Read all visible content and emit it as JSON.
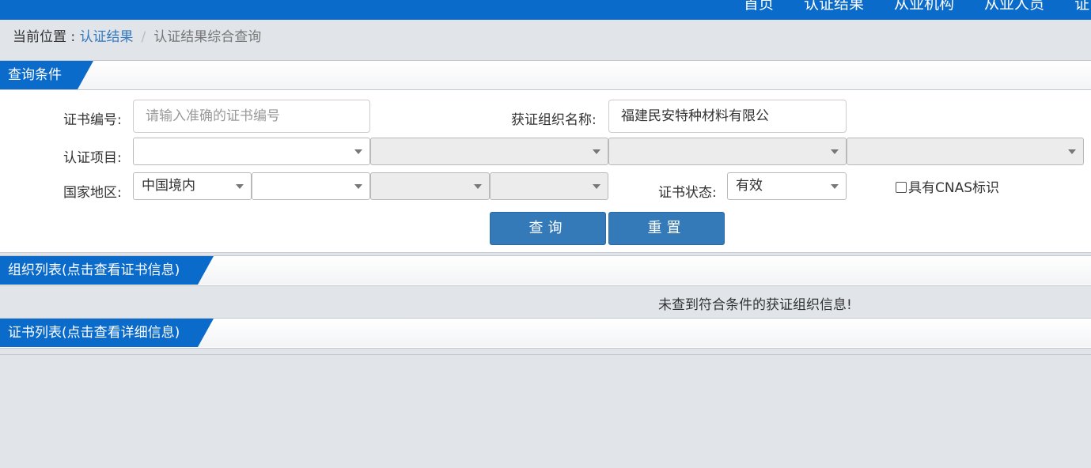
{
  "nav": {
    "items": [
      "首页",
      "认证结果",
      "从业机构",
      "从业人员",
      "证"
    ]
  },
  "breadcrumb": {
    "prefix": "当前位置 : ",
    "link": "认证结果",
    "separator": "/",
    "current": "认证结果综合查询"
  },
  "query_panel": {
    "title": "查询条件",
    "cert_no_label": "证书编号:",
    "cert_no_placeholder": "请输入准确的证书编号",
    "org_name_label": "获证组织名称:",
    "org_name_value": "福建民安特种材料有限公",
    "cert_item_label": "认证项目:",
    "cert_item_selects": [
      "",
      "",
      "",
      ""
    ],
    "region_label": "国家地区:",
    "region_selects": [
      "中国境内",
      "",
      "",
      ""
    ],
    "status_label": "证书状态:",
    "status_value": "有效",
    "cnas_label": "具有CNAS标识",
    "search_button": "查询",
    "reset_button": "重置"
  },
  "org_panel": {
    "title": "组织列表(点击查看证书信息)",
    "empty_message": "未查到符合条件的获证组织信息!"
  },
  "cert_panel": {
    "title": "证书列表(点击查看详细信息)"
  }
}
